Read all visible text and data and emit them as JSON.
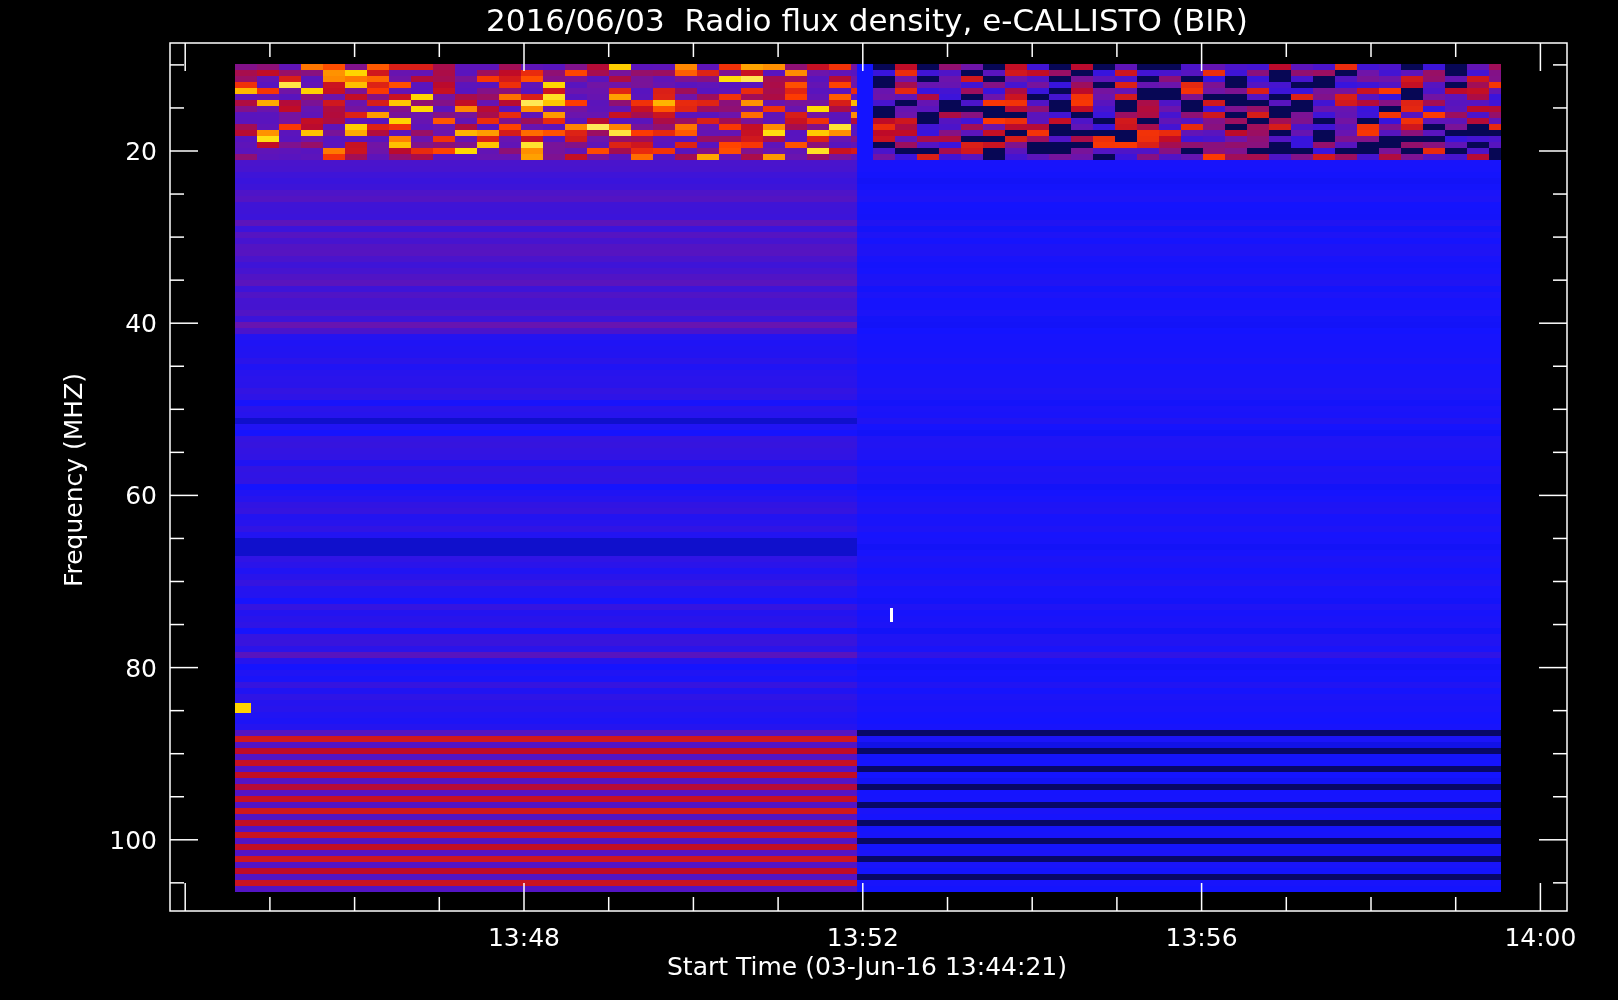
{
  "title": "2016/06/03  Radio flux density, e-CALLISTO (BIR)",
  "x_axis": {
    "label": "Start Time (03-Jun-16 13:44:21)",
    "ticks": [
      "13:48",
      "13:52",
      "13:56",
      "14:00"
    ]
  },
  "y_axis": {
    "label": "Frequency (MHZ)",
    "ticks": [
      "20",
      "40",
      "60",
      "80",
      "100"
    ]
  }
}
